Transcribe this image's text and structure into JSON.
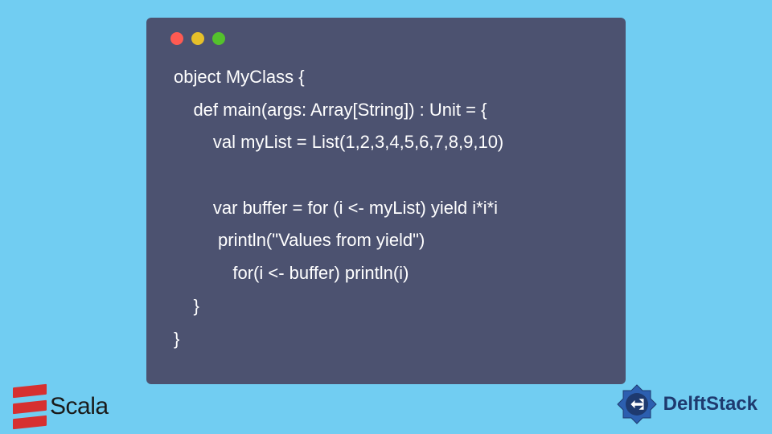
{
  "code": {
    "lines": [
      "object MyClass {",
      "    def main(args: Array[String]) : Unit = {",
      "        val myList = List(1,2,3,4,5,6,7,8,9,10)",
      "",
      "        var buffer = for (i <- myList) yield i*i*i",
      "         println(\"Values from yield\")",
      "            for(i <- buffer) println(i)",
      "    }",
      "}"
    ]
  },
  "scala": {
    "label": "Scala"
  },
  "delft": {
    "label": "DelftStack"
  }
}
